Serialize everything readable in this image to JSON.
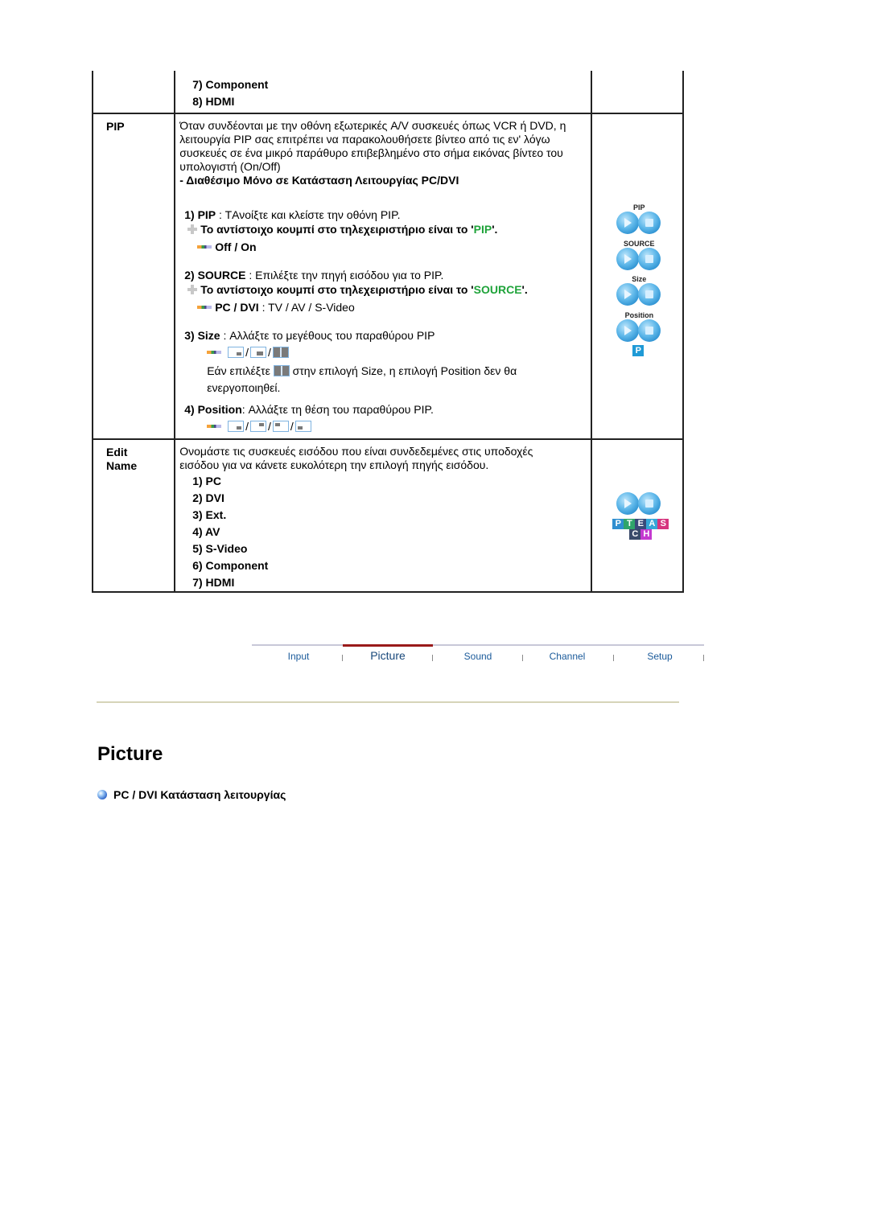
{
  "table": {
    "top_row": {
      "items": [
        "7) Component",
        "8) HDMI"
      ]
    },
    "pip_row": {
      "label": "PIP",
      "description": "Όταν συνδέονται με την οθόνη εξωτερικές A/V συσκευές όπως VCR ή DVD, η λειτουργία PIP σας επιτρέπει να παρακολουθήσετε βίντεο από τις εν' λόγω συσκευές σε ένα μικρό παράθυρο επιβεβλημένο στο σήμα εικόνας βίντεο του υπολογιστή (On/Off)",
      "availability_note": "- Διαθέσιμο Μόνο σε Κατάσταση Λειτουργίας PC/DVI",
      "sub_items": [
        {
          "number": "1)",
          "name": "PIP",
          "separator": " : ",
          "text": "TΑνοίξτε και κλείστε την οθόνη PIP.",
          "remote_note_prefix": "Το αντίστοιχο κουμπί στο τηλεχειριστήριο είναι το '",
          "remote_key": "PIP",
          "remote_note_suffix": "'.",
          "options_bold": "Off / On",
          "options_rest": ""
        },
        {
          "number": "2)",
          "name": "SOURCE",
          "separator": " : ",
          "text": "Επιλέξτε την πηγή εισόδου για το PIP.",
          "remote_note_prefix": "Το αντίστοιχο κουμπί στο τηλεχειριστήριο είναι το '",
          "remote_key": "SOURCE",
          "remote_note_suffix": "'.",
          "options_bold": "PC / DVI",
          "options_rest": " : TV / AV / S-Video"
        },
        {
          "number": "3)",
          "name": "Size",
          "separator": " : ",
          "text": "Αλλάξτε το μεγέθους του παραθύρου PIP",
          "note_before": "Εάν επιλέξτε",
          "note_after": "στην επιλογή Size, η επιλογή Position δεν θα ενεργοποιηθεί.",
          "icon_separator": "/"
        },
        {
          "number": "4)",
          "name": "Position",
          "separator": ": ",
          "text": "Αλλάξτε τη θέση του παραθύρου PIP.",
          "icon_separator": "/"
        }
      ],
      "remote_buttons": [
        "PIP",
        "SOURCE",
        "Size",
        "Position"
      ],
      "remote_key_letter": "P"
    },
    "edit_name_row": {
      "label_line1": "Edit",
      "label_line2": "Name",
      "description": "Ονομάστε τις συσκευές εισόδου που είναι συνδεδεμένες στις υποδοχές εισόδου για να κάνετε ευκολότερη την επιλογή πηγής εισόδου.",
      "items": [
        "1) PC",
        "2) DVI",
        "3) Ext.",
        "4) AV",
        "5) S-Video",
        "6) Component",
        "7) HDMI"
      ],
      "source_keys": [
        {
          "letter": "P",
          "color": "#2f8fd0"
        },
        {
          "letter": "T",
          "color": "#2fa56a"
        },
        {
          "letter": "E",
          "color": "#3a4a7a"
        },
        {
          "letter": "A",
          "color": "#36a7d8"
        },
        {
          "letter": "S",
          "color": "#d6357e"
        },
        {
          "letter": "C",
          "color": "#3a4a6a"
        },
        {
          "letter": "H",
          "color": "#c43ad0"
        }
      ]
    }
  },
  "nav": {
    "tabs": [
      {
        "label": "Input",
        "active": false
      },
      {
        "label": "Picture",
        "active": true
      },
      {
        "label": "Sound",
        "active": false
      },
      {
        "label": "Channel",
        "active": false
      },
      {
        "label": "Setup",
        "active": false
      }
    ],
    "active_color": "#9a1a1a"
  },
  "page_title": "Picture",
  "section_heading": "PC / DVI Κατάσταση λειτουργίας"
}
